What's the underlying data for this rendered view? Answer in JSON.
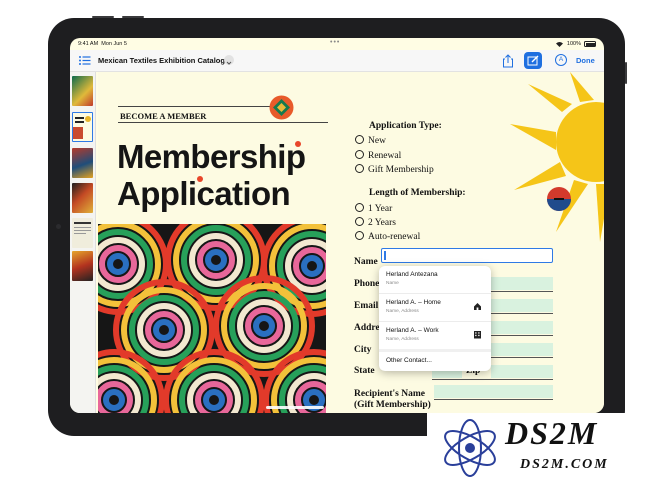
{
  "status_bar": {
    "time": "9:41 AM",
    "date": "Mon Jun 5",
    "battery": "100%"
  },
  "toolbar": {
    "document_title": "Mexican Textiles Exhibition Catalog",
    "done_label": "Done",
    "accent": "#1f6fe0"
  },
  "page": {
    "eyebrow": "BECOME A MEMBER",
    "title_line1": "Membership",
    "title_line2": "Application",
    "application_type": {
      "heading": "Application Type:",
      "options": [
        "New",
        "Renewal",
        "Gift Membership"
      ]
    },
    "membership_length": {
      "heading": "Length of Membership:",
      "options": [
        "1 Year",
        "2 Years",
        "Auto-renewal"
      ]
    },
    "fields": {
      "name": "Name",
      "phone": "Phone",
      "email": "Email",
      "address": "Address",
      "city": "City",
      "state": "State",
      "zip": "Zip",
      "recipient_line1": "Recipient's Name",
      "recipient_line2": "(Gift Membership)"
    }
  },
  "autofill_popup": {
    "items": [
      {
        "title": "Herland Antezana",
        "subtitle": "Name",
        "icon": ""
      },
      {
        "title": "Herland A. – Home",
        "subtitle": "Name, Address",
        "icon": "home-icon"
      },
      {
        "title": "Herland A. – Work",
        "subtitle": "Name, Address",
        "icon": "building-icon"
      }
    ],
    "other_contact": "Other Contact..."
  },
  "watermark": {
    "big": "DS2M",
    "small": "DS2M.COM"
  }
}
